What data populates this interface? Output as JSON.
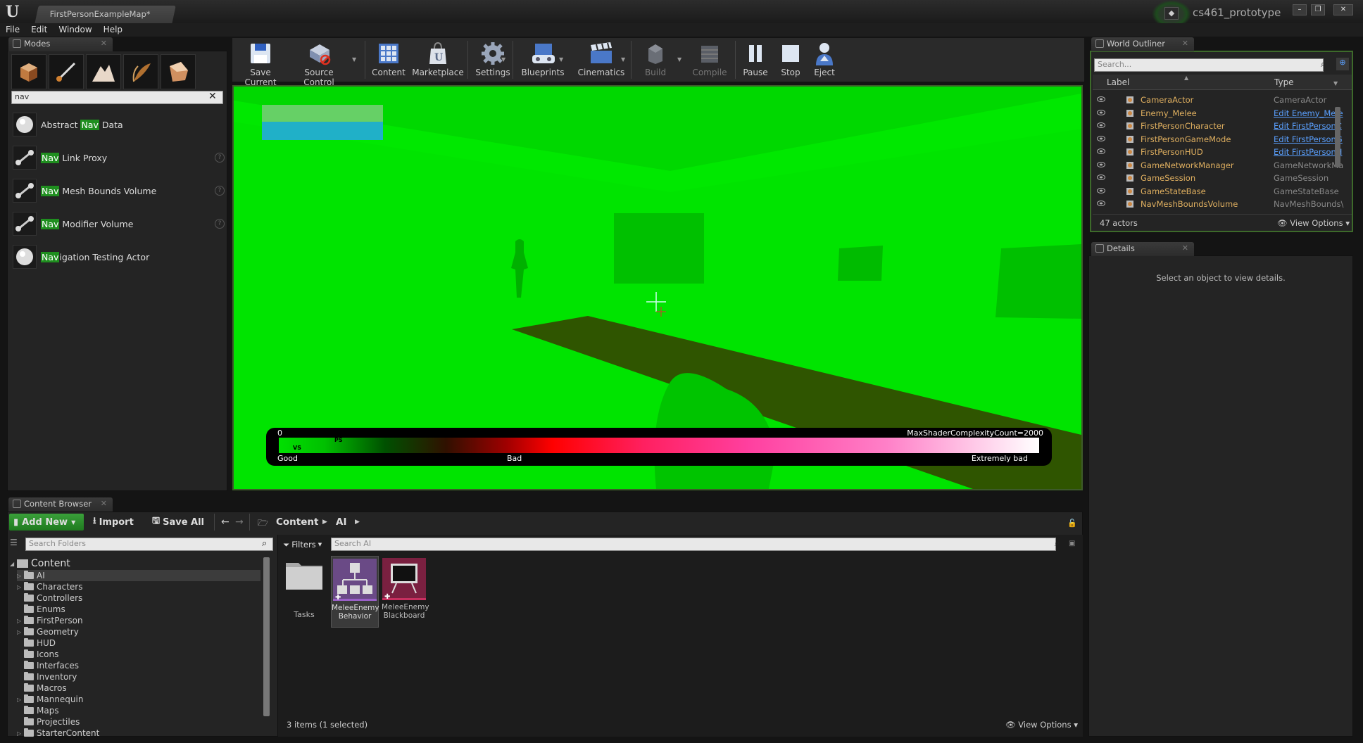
{
  "window": {
    "doc_tab": "FirstPersonExampleMap*",
    "project": "cs461_prototype",
    "menu": [
      "File",
      "Edit",
      "Window",
      "Help"
    ]
  },
  "modes": {
    "tab": "Modes",
    "search_value": "nav",
    "items": [
      {
        "pre": "Abstract ",
        "hl": "Nav",
        "post": " Data",
        "help": false
      },
      {
        "pre": "",
        "hl": "Nav",
        "post": " Link Proxy",
        "help": true
      },
      {
        "pre": "",
        "hl": "Nav",
        "post": " Mesh Bounds Volume",
        "help": true
      },
      {
        "pre": "",
        "hl": "Nav",
        "post": " Modifier Volume",
        "help": true
      },
      {
        "pre": "",
        "hl": "Nav",
        "post": "igation Testing Actor",
        "help": false
      }
    ]
  },
  "toolbar": {
    "buttons": [
      "Save Current",
      "Source Control",
      "Content",
      "Marketplace",
      "Settings",
      "Blueprints",
      "Cinematics",
      "Build",
      "Compile",
      "Pause",
      "Stop",
      "Eject"
    ]
  },
  "viewport": {
    "legend_zero": "0",
    "legend_max": "MaxShaderComplexityCount=2000",
    "label_good": "Good",
    "label_bad": "Bad",
    "label_extreme": "Extremely bad",
    "marker_ps": "PS",
    "marker_vs": "VS",
    "colors": {
      "bg": "#00e400",
      "floor_shadow": "#2f5500"
    }
  },
  "outliner": {
    "tab": "World Outliner",
    "search_placeholder": "Search...",
    "col_label": "Label",
    "col_type": "Type",
    "rows": [
      {
        "label": "CameraActor",
        "type": "CameraActor",
        "link": false
      },
      {
        "label": "Enemy_Melee",
        "type": "Edit Enemy_Mele",
        "link": true
      },
      {
        "label": "FirstPersonCharacter",
        "type": "Edit FirstPersonC",
        "link": true
      },
      {
        "label": "FirstPersonGameMode",
        "type": "Edit FirstPersonG",
        "link": true
      },
      {
        "label": "FirstPersonHUD",
        "type": "Edit FirstPersonH",
        "link": true
      },
      {
        "label": "GameNetworkManager",
        "type": "GameNetworkMar",
        "link": false
      },
      {
        "label": "GameSession",
        "type": "GameSession",
        "link": false
      },
      {
        "label": "GameStateBase",
        "type": "GameStateBase",
        "link": false
      },
      {
        "label": "NavMeshBoundsVolume",
        "type": "NavMeshBounds\\",
        "link": false
      }
    ],
    "count": "47 actors",
    "view_options": "View Options"
  },
  "details": {
    "tab": "Details",
    "empty": "Select an object to view details."
  },
  "content_browser": {
    "tab": "Content Browser",
    "add_new": "Add New",
    "import": "Import",
    "save_all": "Save All",
    "path": [
      "Content",
      "AI"
    ],
    "search_folders": "Search Folders",
    "filters": "Filters",
    "search_assets": "Search AI",
    "root": "Content",
    "folders": [
      {
        "name": "AI",
        "arrow": true,
        "selected": true
      },
      {
        "name": "Characters",
        "arrow": true
      },
      {
        "name": "Controllers",
        "arrow": false
      },
      {
        "name": "Enums",
        "arrow": false
      },
      {
        "name": "FirstPerson",
        "arrow": true
      },
      {
        "name": "Geometry",
        "arrow": true
      },
      {
        "name": "HUD",
        "arrow": false
      },
      {
        "name": "Icons",
        "arrow": false
      },
      {
        "name": "Interfaces",
        "arrow": false
      },
      {
        "name": "Inventory",
        "arrow": false
      },
      {
        "name": "Macros",
        "arrow": false
      },
      {
        "name": "Mannequin",
        "arrow": true
      },
      {
        "name": "Maps",
        "arrow": false
      },
      {
        "name": "Projectiles",
        "arrow": false
      },
      {
        "name": "StarterContent",
        "arrow": true
      }
    ],
    "assets": [
      {
        "name": "Tasks",
        "kind": "folder"
      },
      {
        "name": "MeleeEnemy Behavior",
        "l1": "MeleeEnemy",
        "l2": "Behavior",
        "kind": "behavior-tree"
      },
      {
        "name": "MeleeEnemy Blackboard",
        "l1": "MeleeEnemy",
        "l2": "Blackboard",
        "kind": "blackboard"
      }
    ],
    "status": "3 items (1 selected)",
    "view_options": "View Options"
  }
}
